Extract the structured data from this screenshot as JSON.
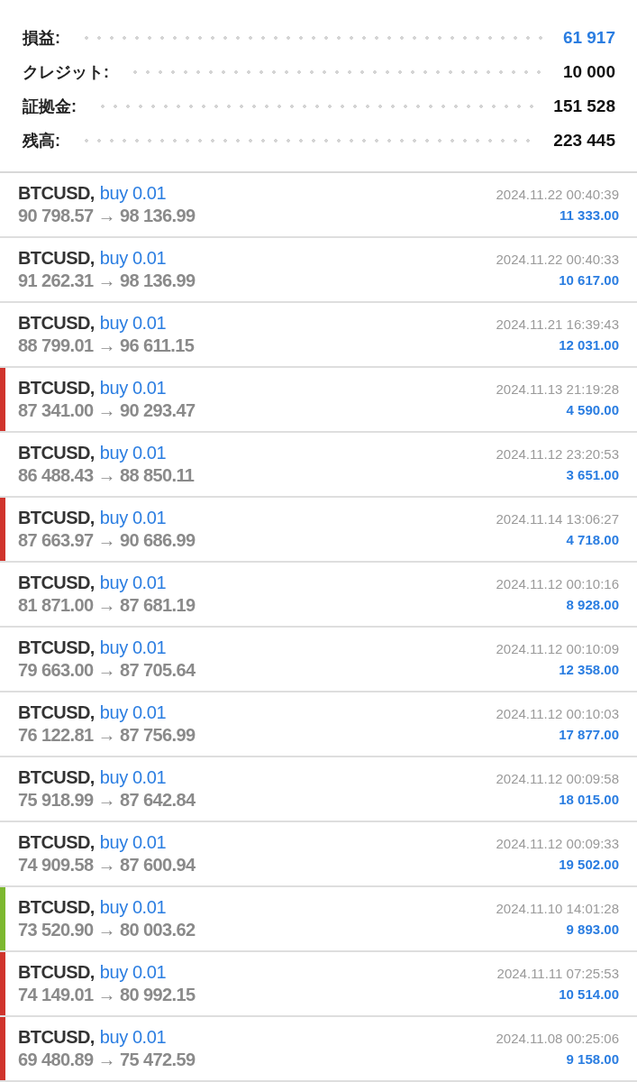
{
  "summary": [
    {
      "label": "損益:",
      "value": "61 917",
      "color": "#2a7de1"
    },
    {
      "label": "クレジット:",
      "value": "10 000",
      "color": "#111111"
    },
    {
      "label": "証拠金:",
      "value": "151 528",
      "color": "#111111"
    },
    {
      "label": "残高:",
      "value": "223 445",
      "color": "#111111"
    }
  ],
  "trades": [
    {
      "symbol": "BTCUSD,",
      "order": "buy 0.01",
      "prices": "90 798.57 → 98 136.99",
      "time": "2024.11.22 00:40:39",
      "profit": "11 333.00"
    },
    {
      "symbol": "BTCUSD,",
      "order": "buy 0.01",
      "prices": "91 262.31 → 98 136.99",
      "time": "2024.11.22 00:40:33",
      "profit": "10 617.00"
    },
    {
      "symbol": "BTCUSD,",
      "order": "buy 0.01",
      "prices": "88 799.01 → 96 611.15",
      "time": "2024.11.21 16:39:43",
      "profit": "12 031.00"
    },
    {
      "symbol": "BTCUSD,",
      "order": "buy 0.01",
      "prices": "87 341.00 → 90 293.47",
      "time": "2024.11.13 21:19:28",
      "profit": "4 590.00",
      "color": "#d0342c"
    },
    {
      "symbol": "BTCUSD,",
      "order": "buy 0.01",
      "prices": "86 488.43 → 88 850.11",
      "time": "2024.11.12 23:20:53",
      "profit": "3 651.00"
    },
    {
      "symbol": "BTCUSD,",
      "order": "buy 0.01",
      "prices": "87 663.97 → 90 686.99",
      "time": "2024.11.14 13:06:27",
      "profit": "4 718.00",
      "color": "#d0342c"
    },
    {
      "symbol": "BTCUSD,",
      "order": "buy 0.01",
      "prices": "81 871.00 → 87 681.19",
      "time": "2024.11.12 00:10:16",
      "profit": "8 928.00"
    },
    {
      "symbol": "BTCUSD,",
      "order": "buy 0.01",
      "prices": "79 663.00 → 87 705.64",
      "time": "2024.11.12 00:10:09",
      "profit": "12 358.00"
    },
    {
      "symbol": "BTCUSD,",
      "order": "buy 0.01",
      "prices": "76 122.81 → 87 756.99",
      "time": "2024.11.12 00:10:03",
      "profit": "17 877.00"
    },
    {
      "symbol": "BTCUSD,",
      "order": "buy 0.01",
      "prices": "75 918.99 → 87 642.84",
      "time": "2024.11.12 00:09:58",
      "profit": "18 015.00"
    },
    {
      "symbol": "BTCUSD,",
      "order": "buy 0.01",
      "prices": "74 909.58 → 87 600.94",
      "time": "2024.11.12 00:09:33",
      "profit": "19 502.00"
    },
    {
      "symbol": "BTCUSD,",
      "order": "buy 0.01",
      "prices": "73 520.90 → 80 003.62",
      "time": "2024.11.10 14:01:28",
      "profit": "9 893.00",
      "color": "#7cb82f"
    },
    {
      "symbol": "BTCUSD,",
      "order": "buy 0.01",
      "prices": "74 149.01 → 80 992.15",
      "time": "2024.11.11 07:25:53",
      "profit": "10 514.00",
      "color": "#d0342c"
    },
    {
      "symbol": "BTCUSD,",
      "order": "buy 0.01",
      "prices": "69 480.89 → 75 472.59",
      "time": "2024.11.08 00:25:06",
      "profit": "9 158.00",
      "color": "#d0342c"
    }
  ]
}
